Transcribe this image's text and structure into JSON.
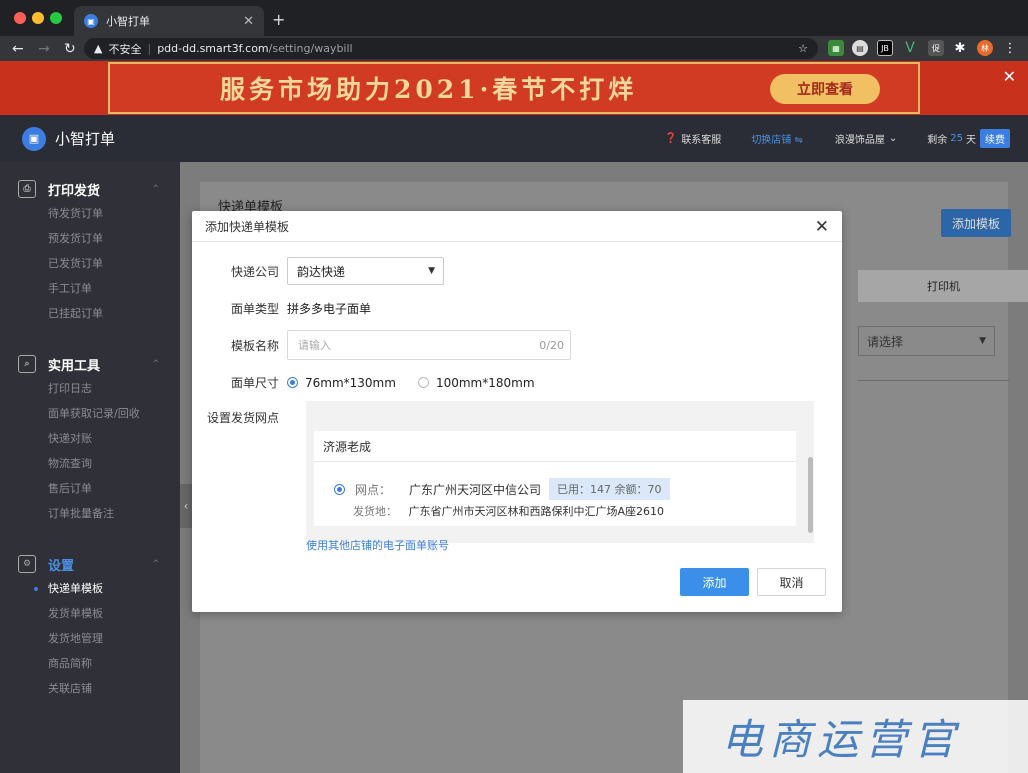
{
  "browser": {
    "tab_title": "小智打单",
    "url_security": "不安全",
    "url_host": "pdd-dd.smart3f.com",
    "url_path": "/setting/waybill"
  },
  "banner": {
    "text": "服务市场助力2021·春节不打烊",
    "button": "立即查看"
  },
  "app": {
    "name": "小智打单",
    "header": {
      "support": "联系客服",
      "switch_shop": "切换店铺 ⇋",
      "shop_name": "浪漫饰品屋",
      "remaining_label": "剩余",
      "remaining_days": "25",
      "days_unit": "天",
      "renew": "续费"
    }
  },
  "sidebar": {
    "groups": [
      {
        "title": "打印发货",
        "items": [
          "待发货订单",
          "预发货订单",
          "已发货订单",
          "手工订单",
          "已挂起订单"
        ]
      },
      {
        "title": "实用工具",
        "items": [
          "打印日志",
          "面单获取记录/回收",
          "快递对账",
          "物流查询",
          "售后订单",
          "订单批量备注"
        ]
      },
      {
        "title": "设置",
        "items": [
          "快递单模板",
          "发货单模板",
          "发货地管理",
          "商品简称",
          "关联店铺"
        ]
      }
    ]
  },
  "page": {
    "title": "快递单模板",
    "add_button": "添加模板",
    "printer_col": "打印机",
    "select_placeholder": "请选择"
  },
  "modal": {
    "title": "添加快递单模板",
    "company_label": "快递公司",
    "company_value": "韵达快递",
    "type_label": "面单类型",
    "type_value": "拼多多电子面单",
    "name_label": "模板名称",
    "name_placeholder": "请输入",
    "name_count": "0/20",
    "size_label": "面单尺寸",
    "size_options": [
      "76mm*130mm",
      "100mm*180mm"
    ],
    "selected_size": 0,
    "site_label": "设置发货网点",
    "account_name": "济源老成",
    "site_key": "网点：",
    "site_value": "广东广州天河区中信公司",
    "site_usage": "已用：147 余额：70",
    "ship_key": "发货地：",
    "ship_value": "广东省广州市天河区林和西路保利中汇广场A座2610",
    "other_link": "使用其他店铺的电子面单账号",
    "confirm": "添加",
    "cancel": "取消"
  },
  "watermark": "电商运营官"
}
